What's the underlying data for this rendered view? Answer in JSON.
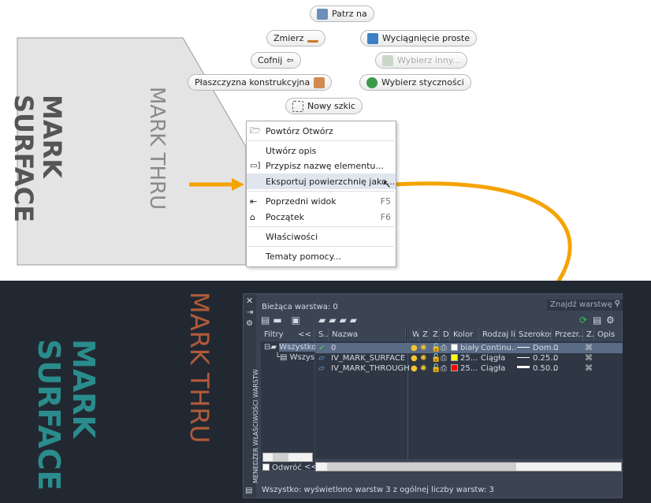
{
  "drawing_top": {
    "mark_surface": [
      "MARK",
      "SURFACE"
    ],
    "mark_thru": "MARK THRU"
  },
  "ribbon_buttons": {
    "patrz_na": "Patrz na",
    "zmierz": "Zmierz",
    "wyciagniecie": "Wyciągnięcie proste",
    "cofnij": "Cofnij",
    "wybierz_inny": "Wybierz inny...",
    "plaszczyzna": "Płaszczyzna konstrukcyjna",
    "wybierz_stycznosci": "Wybierz styczności",
    "nowy_szkic": "Nowy szkic"
  },
  "context_menu": {
    "items": [
      {
        "label": "Powtórz Otwórz",
        "icon": "folder-icon"
      },
      {
        "label": "Utwórz opis"
      },
      {
        "label": "Przypisz nazwę elementu...",
        "icon": "rename-icon"
      },
      {
        "label": "Eksportuj powierzchnię jako...",
        "highlighted": true
      },
      {
        "label": "Poprzedni widok",
        "shortcut": "F5",
        "icon": "back-arrow-icon"
      },
      {
        "label": "Początek",
        "shortcut": "F6",
        "icon": "home-icon"
      },
      {
        "label": "Właściwości"
      },
      {
        "label": "Tematy pomocy..."
      }
    ]
  },
  "colors": {
    "arrow": "#f5a300",
    "dark_bg": "#222831",
    "panel": "#3b4453",
    "teal": "#2a8c8c",
    "orange_text": "#b05a3a"
  },
  "layer_manager": {
    "side_title": "MENEDŻER WŁAŚCIWOŚCI WARSTW",
    "current_layer": "Bieżąca warstwa: 0",
    "search_placeholder": "Znajdź warstwę",
    "filters_label": "Filtry",
    "collapse": "<<",
    "tree": [
      "Wszystko",
      "Wszys"
    ],
    "invert_label": "Odwróć",
    "columns": [
      "S..",
      "Nazwa",
      "W",
      "Z..",
      "Z..",
      "D..",
      "Kolor",
      "Rodzaj li...",
      "Szerokoś...",
      "Przezr...",
      "Z..",
      "Opis"
    ],
    "rows": [
      {
        "name": "0",
        "color_name": "biały",
        "color": "#ffffff",
        "linetype": "Continu...",
        "lineweight": "Dom...",
        "transparency": "0",
        "current": true
      },
      {
        "name": "IV_MARK_SURFACE",
        "color_name": "25...",
        "color": "#ffff00",
        "linetype": "Ciągła",
        "lineweight": "0.25...",
        "transparency": "0"
      },
      {
        "name": "IV_MARK_THROUGH",
        "color_name": "25...",
        "color": "#ff0000",
        "linetype": "Ciągła",
        "lineweight": "0.50...",
        "transparency": "0"
      }
    ],
    "status": "Wszystko: wyświetlono warstw 3 z ogólnej liczby warstw: 3"
  }
}
